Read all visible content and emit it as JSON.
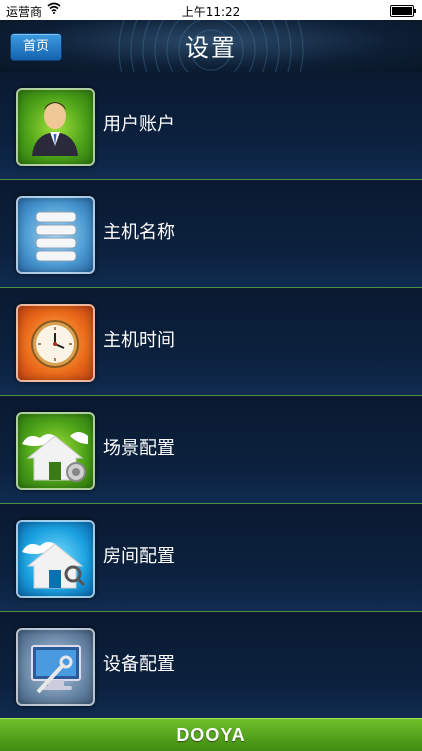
{
  "status_bar": {
    "carrier": "运营商",
    "time": "上午11:22"
  },
  "header": {
    "home_button": "首页",
    "title": "设置"
  },
  "menu": {
    "items": [
      {
        "label": "用户账户",
        "icon": "user-account-icon",
        "color": "#4aa018"
      },
      {
        "label": "主机名称",
        "icon": "host-name-icon",
        "color": "#4a9ad2"
      },
      {
        "label": "主机时间",
        "icon": "clock-icon",
        "color": "#ea6a1a"
      },
      {
        "label": "场景配置",
        "icon": "scene-config-icon",
        "color": "#4aa018"
      },
      {
        "label": "房间配置",
        "icon": "room-config-icon",
        "color": "#1aa0e0"
      },
      {
        "label": "设备配置",
        "icon": "device-config-icon",
        "color": "#6a88a8"
      }
    ]
  },
  "footer": {
    "brand": "DOOYA"
  }
}
